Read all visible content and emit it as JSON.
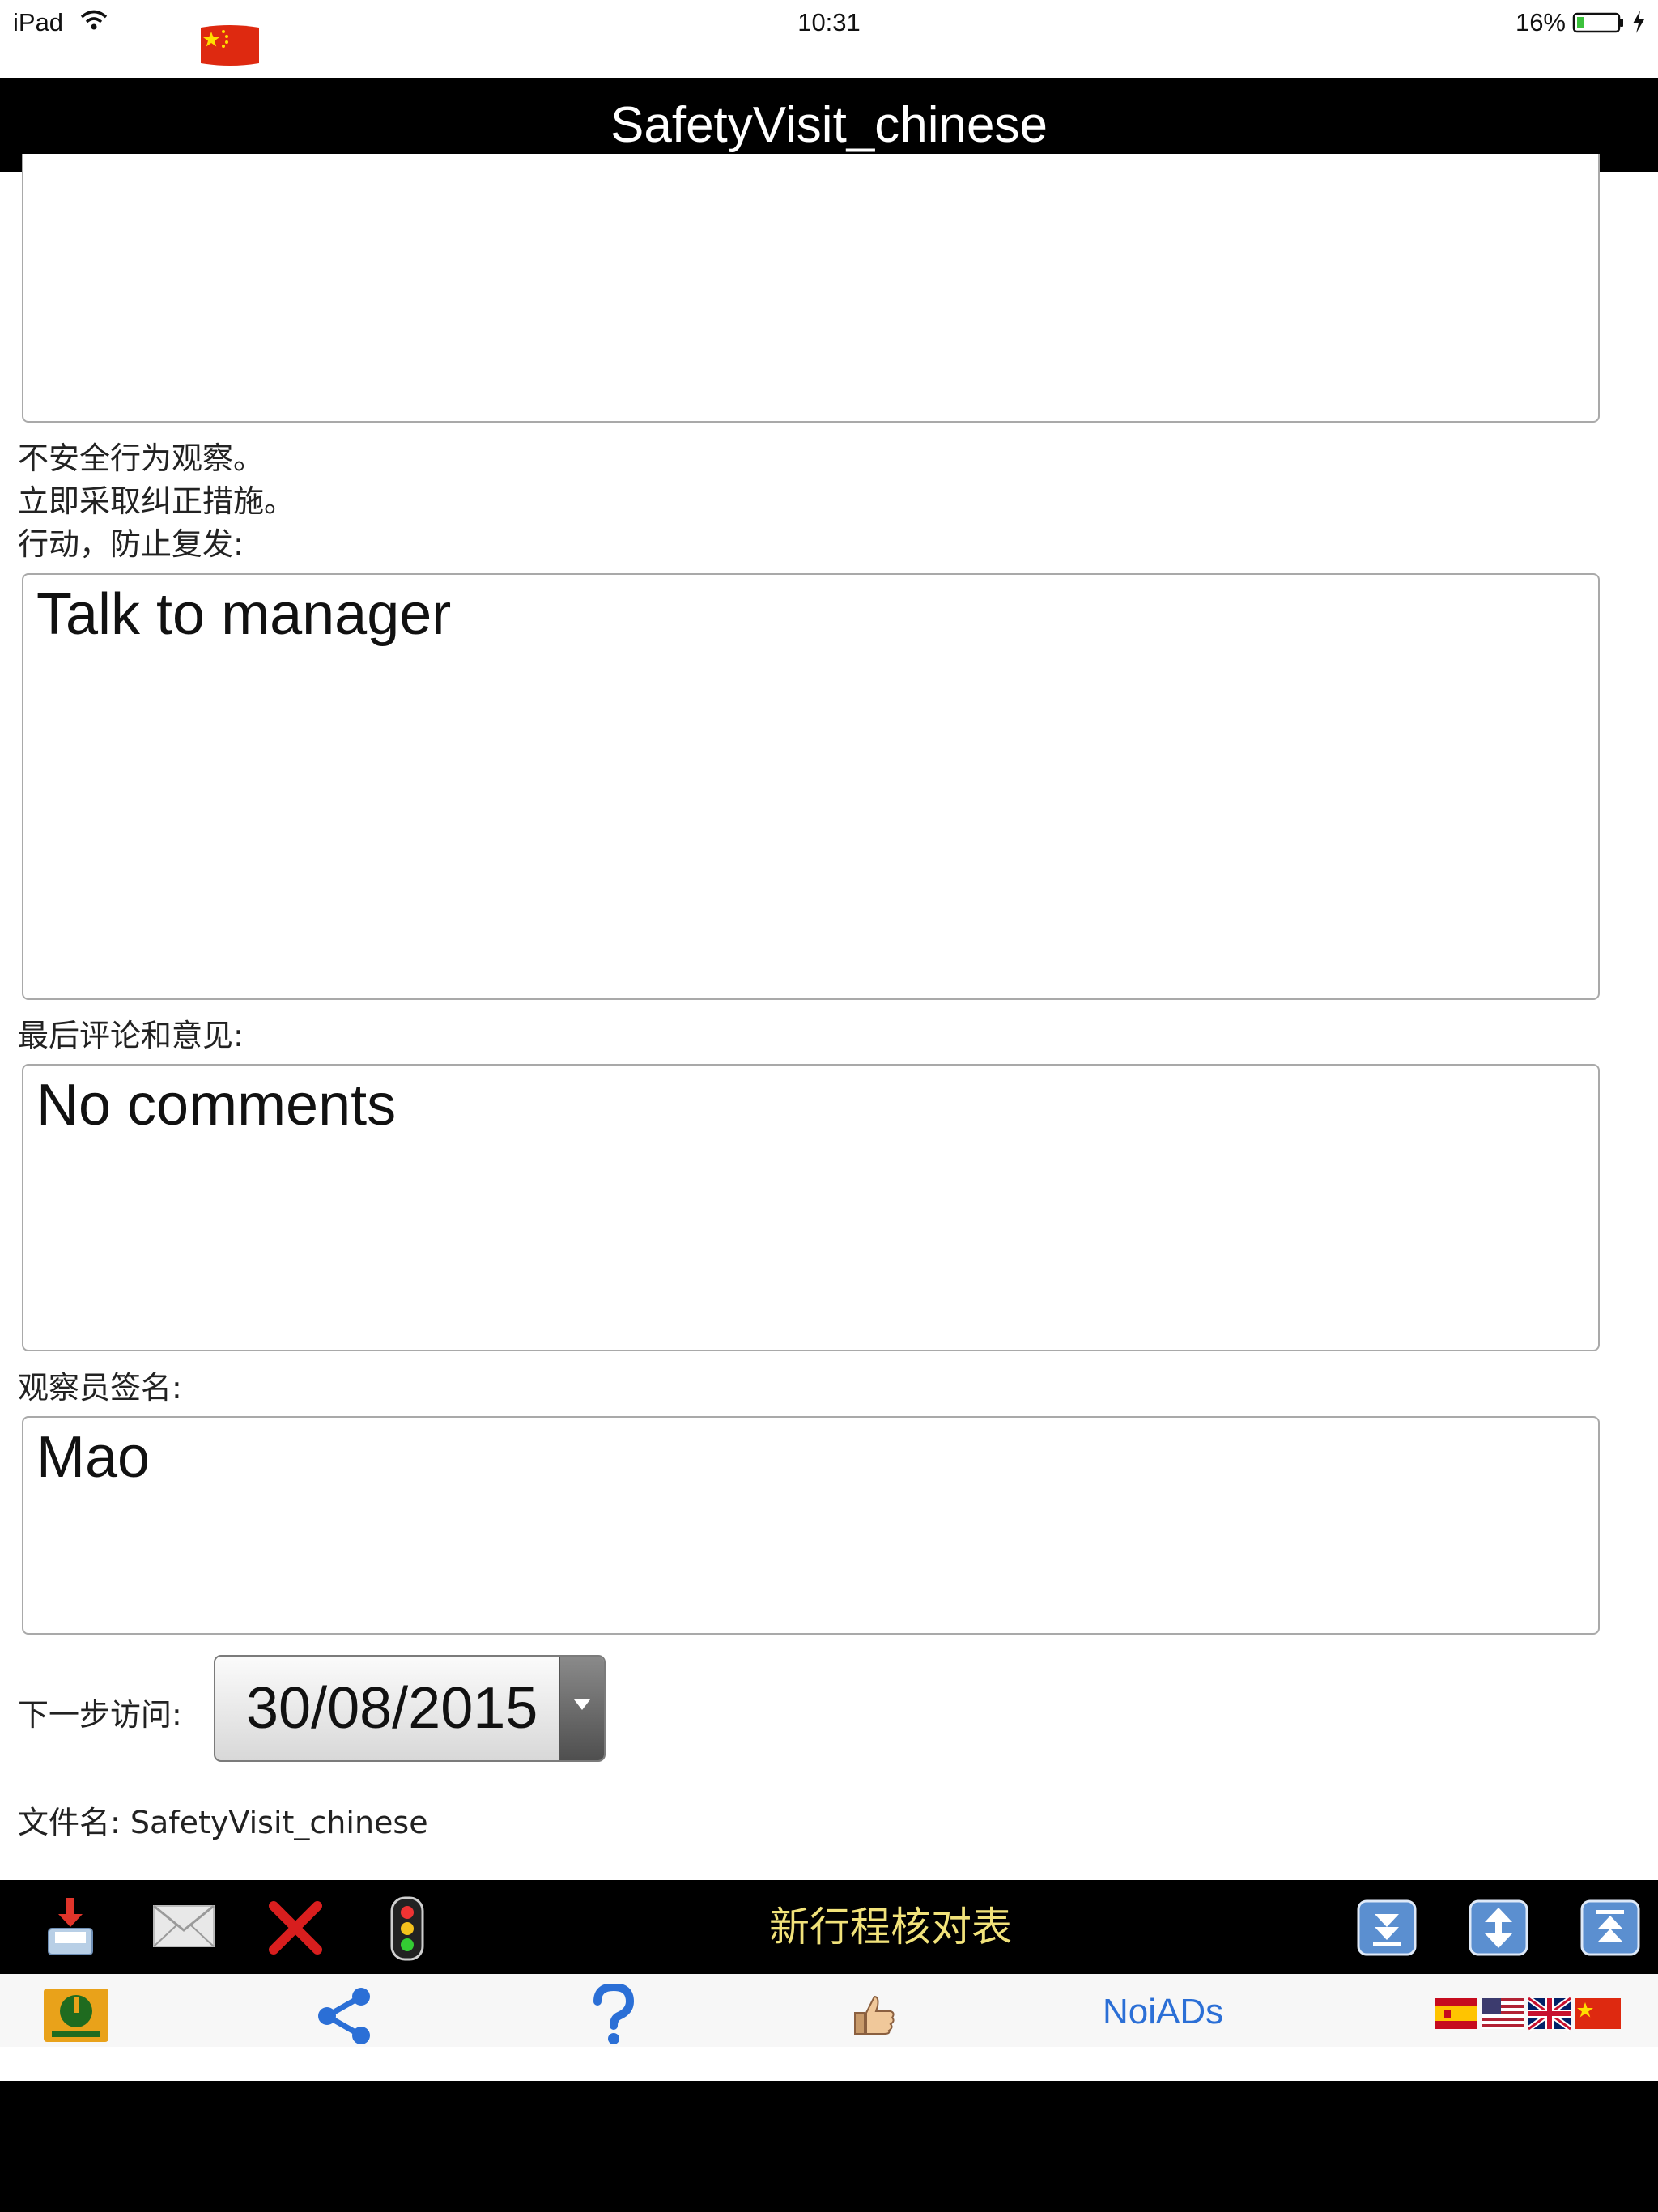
{
  "status_bar": {
    "carrier": "iPad",
    "time": "10:31",
    "battery": "16%"
  },
  "header": {
    "title": "SafetyVisit_chinese"
  },
  "form": {
    "box0_value": "",
    "label_unsafe_lines": [
      "不安全行为观察。",
      "立即采取纠正措施。",
      "行动，防止复发:"
    ],
    "actions_value": "Talk to manager",
    "final_comments_label": "最后评论和意见:",
    "final_comments_value": "No comments",
    "observer_signature_label": "观察员签名:",
    "observer_signature_value": "Mao",
    "next_visit_label": "下一步访问:",
    "next_visit_date": "30/08/2015",
    "filename_label": "文件名: SafetyVisit_chinese"
  },
  "toolbar": {
    "title": "新行程核对表",
    "icons": [
      "download-tray-icon",
      "mail-icon",
      "delete-x-icon",
      "traffic-light-icon",
      "scroll-bottom-icon",
      "scroll-middle-icon",
      "scroll-top-icon"
    ]
  },
  "bottom_bar": {
    "noiads_label": "NoiADs",
    "icons": [
      "app-logo-icon",
      "share-icon",
      "help-icon",
      "thumbs-up-icon",
      "flags-icon"
    ]
  },
  "colors": {
    "toolbar_title": "#f1e27a",
    "link_blue": "#2b6fd6",
    "delete_red": "#d81e1e"
  }
}
